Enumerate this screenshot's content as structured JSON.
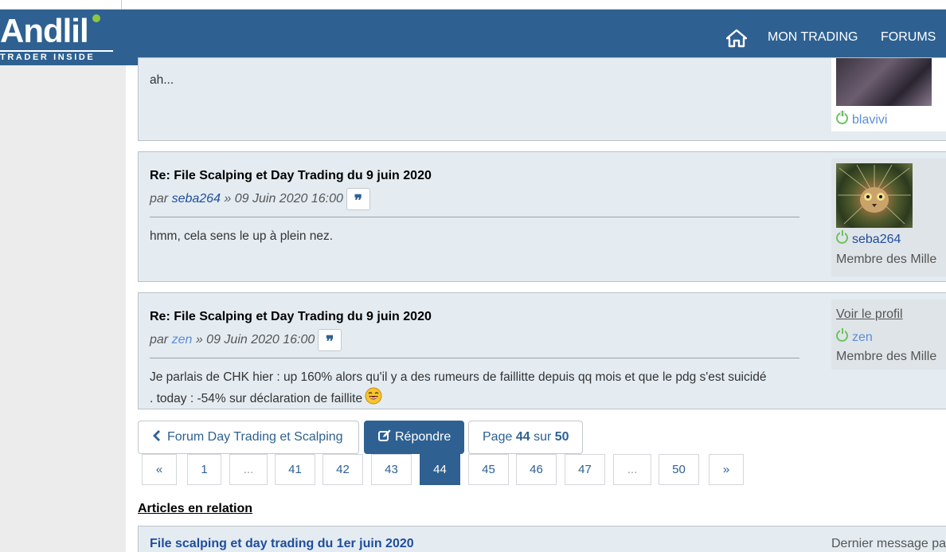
{
  "header": {
    "logo_main": "Andlil",
    "logo_sub": "TRADER INSIDE",
    "nav": [
      {
        "label": "MON TRADING"
      },
      {
        "label": "FORUMS"
      }
    ]
  },
  "posts": [
    {
      "body": "ah...",
      "username": "blavivi"
    },
    {
      "title": "Re: File Scalping et Day Trading du 9 juin 2020",
      "by": "par",
      "author": "seba264",
      "date": "» 09 Juin 2020 16:00",
      "body": "hmm, cela sens le up à plein nez.",
      "username": "seba264",
      "rank": "Membre des Mille"
    },
    {
      "title": "Re: File Scalping et Day Trading du 9 juin 2020",
      "by": "par",
      "author": "zen",
      "date": "» 09 Juin 2020 16:00",
      "body_line1": "Je parlais de CHK hier : up 160% alors qu'il y a des rumeurs de faillitte depuis qq mois et que le pdg s'est suicidé",
      "body_line2": ". today : -54% sur déclaration de faillite",
      "view_profile": "Voir le profil",
      "username": "zen",
      "rank": "Membre des Mille"
    }
  ],
  "quote_glyph": "❞",
  "actions": {
    "back_label": "Forum Day Trading et Scalping",
    "reply_label": "Répondre",
    "page_prefix": "Page",
    "page_current": "44",
    "page_sep": "sur",
    "page_total": "50"
  },
  "pagination": [
    "«",
    "1",
    "...",
    "41",
    "42",
    "43",
    "44",
    "45",
    "46",
    "47",
    "...",
    "50",
    "»"
  ],
  "pagination_active": "44",
  "related": {
    "heading": "Articles en relation",
    "first_title": "File scalping et day trading du 1er juin 2020",
    "last_message": "Dernier message par"
  },
  "colors": {
    "header_bg": "#2e6191",
    "post_bg": "#e4ecf2",
    "online": "#6ac45a"
  }
}
